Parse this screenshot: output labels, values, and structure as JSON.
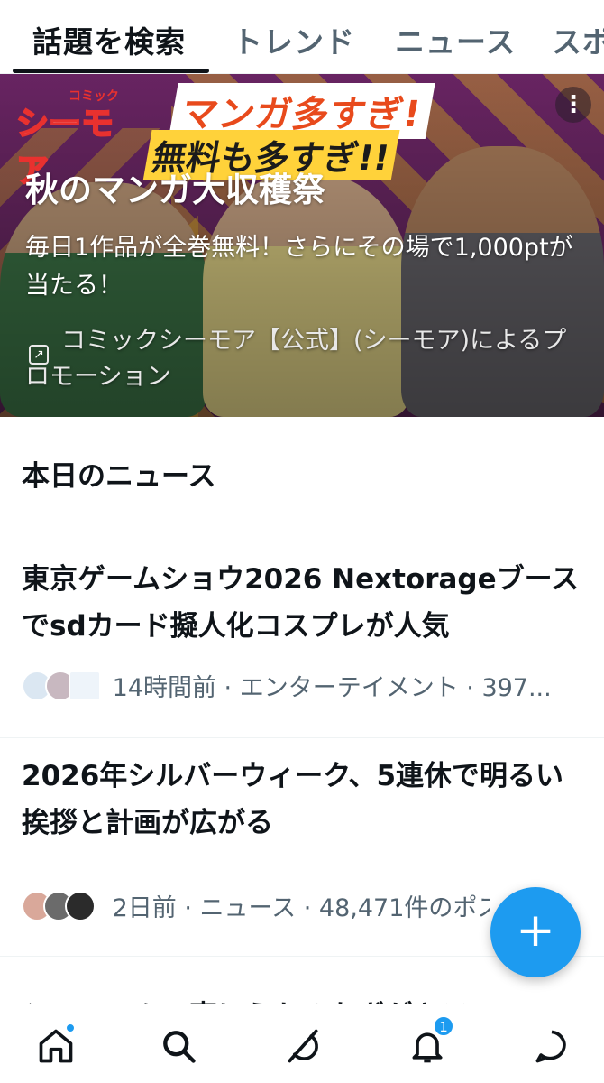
{
  "tabs": [
    {
      "label": "話題を検索",
      "active": true
    },
    {
      "label": "トレンド",
      "active": false
    },
    {
      "label": "ニュース",
      "active": false
    },
    {
      "label": "スポ",
      "active": false
    }
  ],
  "promo": {
    "logo_small": "コミック",
    "logo_main": "シーモア",
    "slogan_line1": "マンガ多すぎ!",
    "slogan_line2": "無料も多すぎ!!",
    "title": "秋のマンガ大収穫祭",
    "description": "毎日1作品が全巻無料！さらにその場で1,000ptが当たる！",
    "sponsor": "コミックシーモア【公式】(シーモア)によるプロモーション",
    "menu_icon": "more-dots-icon",
    "link_icon": "external-link-icon"
  },
  "section": {
    "title": "本日のニュース"
  },
  "news": [
    {
      "headline": "東京ゲームショウ2026 Nextorageブースでsdカード擬人化コスプレが人気",
      "meta": "14時間前 · エンターテイメント · 397..."
    },
    {
      "headline": "2026年シルバーウィーク、5連休で明るい挨拶と計画が広がる",
      "meta": "2日前 · ニュース · 48,471件のポス"
    },
    {
      "headline": "シニア・ムの声にうちみなぎがキラ"
    }
  ],
  "fab": {
    "label": "+"
  },
  "bottom_nav": {
    "items": [
      {
        "name": "home-icon",
        "has_dot": true
      },
      {
        "name": "search-icon"
      },
      {
        "name": "grok-icon"
      },
      {
        "name": "notifications-icon",
        "badge": "1"
      },
      {
        "name": "messages-icon"
      }
    ]
  },
  "colors": {
    "accent": "#1d9bf0",
    "text_primary": "#0f1419",
    "text_secondary": "#536471",
    "promo_bg": "#6f2a68"
  }
}
